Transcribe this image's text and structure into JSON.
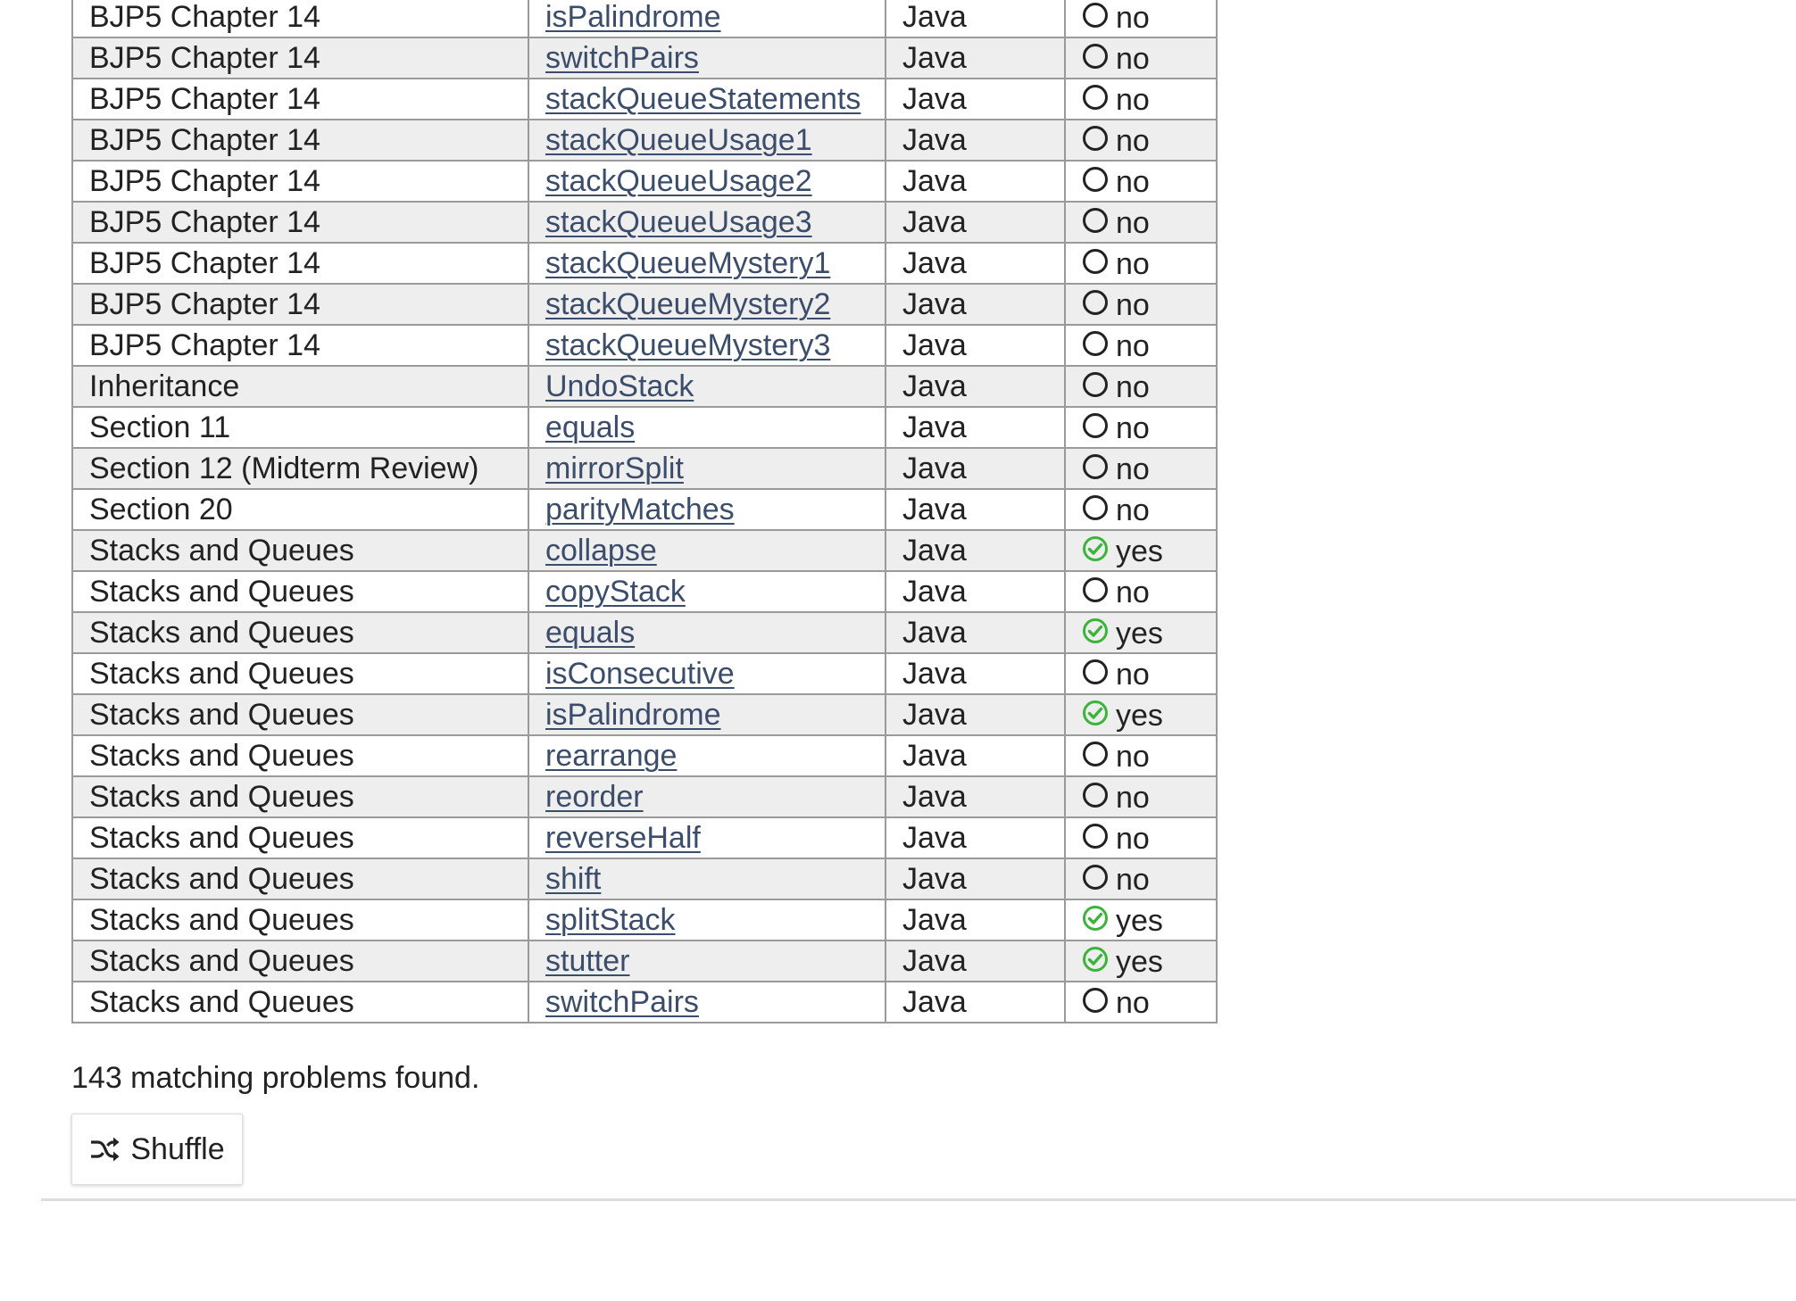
{
  "table": {
    "rows": [
      {
        "category": "BJP5 Chapter 14",
        "problem": "isPalindrome",
        "language": "Java",
        "solved": false,
        "status_label": "no"
      },
      {
        "category": "BJP5 Chapter 14",
        "problem": "switchPairs",
        "language": "Java",
        "solved": false,
        "status_label": "no"
      },
      {
        "category": "BJP5 Chapter 14",
        "problem": "stackQueueStatements",
        "language": "Java",
        "solved": false,
        "status_label": "no"
      },
      {
        "category": "BJP5 Chapter 14",
        "problem": "stackQueueUsage1",
        "language": "Java",
        "solved": false,
        "status_label": "no"
      },
      {
        "category": "BJP5 Chapter 14",
        "problem": "stackQueueUsage2",
        "language": "Java",
        "solved": false,
        "status_label": "no"
      },
      {
        "category": "BJP5 Chapter 14",
        "problem": "stackQueueUsage3",
        "language": "Java",
        "solved": false,
        "status_label": "no"
      },
      {
        "category": "BJP5 Chapter 14",
        "problem": "stackQueueMystery1",
        "language": "Java",
        "solved": false,
        "status_label": "no"
      },
      {
        "category": "BJP5 Chapter 14",
        "problem": "stackQueueMystery2",
        "language": "Java",
        "solved": false,
        "status_label": "no"
      },
      {
        "category": "BJP5 Chapter 14",
        "problem": "stackQueueMystery3",
        "language": "Java",
        "solved": false,
        "status_label": "no"
      },
      {
        "category": "Inheritance",
        "problem": "UndoStack",
        "language": "Java",
        "solved": false,
        "status_label": "no"
      },
      {
        "category": "Section 11",
        "problem": "equals",
        "language": "Java",
        "solved": false,
        "status_label": "no"
      },
      {
        "category": "Section 12 (Midterm Review)",
        "problem": "mirrorSplit",
        "language": "Java",
        "solved": false,
        "status_label": "no"
      },
      {
        "category": "Section 20",
        "problem": "parityMatches",
        "language": "Java",
        "solved": false,
        "status_label": "no"
      },
      {
        "category": "Stacks and Queues",
        "problem": "collapse",
        "language": "Java",
        "solved": true,
        "status_label": "yes"
      },
      {
        "category": "Stacks and Queues",
        "problem": "copyStack",
        "language": "Java",
        "solved": false,
        "status_label": "no"
      },
      {
        "category": "Stacks and Queues",
        "problem": "equals",
        "language": "Java",
        "solved": true,
        "status_label": "yes"
      },
      {
        "category": "Stacks and Queues",
        "problem": "isConsecutive",
        "language": "Java",
        "solved": false,
        "status_label": "no"
      },
      {
        "category": "Stacks and Queues",
        "problem": "isPalindrome",
        "language": "Java",
        "solved": true,
        "status_label": "yes"
      },
      {
        "category": "Stacks and Queues",
        "problem": "rearrange",
        "language": "Java",
        "solved": false,
        "status_label": "no"
      },
      {
        "category": "Stacks and Queues",
        "problem": "reorder",
        "language": "Java",
        "solved": false,
        "status_label": "no"
      },
      {
        "category": "Stacks and Queues",
        "problem": "reverseHalf",
        "language": "Java",
        "solved": false,
        "status_label": "no"
      },
      {
        "category": "Stacks and Queues",
        "problem": "shift",
        "language": "Java",
        "solved": false,
        "status_label": "no"
      },
      {
        "category": "Stacks and Queues",
        "problem": "splitStack",
        "language": "Java",
        "solved": true,
        "status_label": "yes"
      },
      {
        "category": "Stacks and Queues",
        "problem": "stutter",
        "language": "Java",
        "solved": true,
        "status_label": "yes"
      },
      {
        "category": "Stacks and Queues",
        "problem": "switchPairs",
        "language": "Java",
        "solved": false,
        "status_label": "no"
      }
    ]
  },
  "summary": {
    "text": "143 matching problems found."
  },
  "shuffle": {
    "label": "Shuffle",
    "icon": "shuffle-icon"
  },
  "colors": {
    "link": "#3b4d6b",
    "solved_check": "#3cb43c",
    "row_stripe": "#eeeeee",
    "border": "#9a9a9a"
  }
}
